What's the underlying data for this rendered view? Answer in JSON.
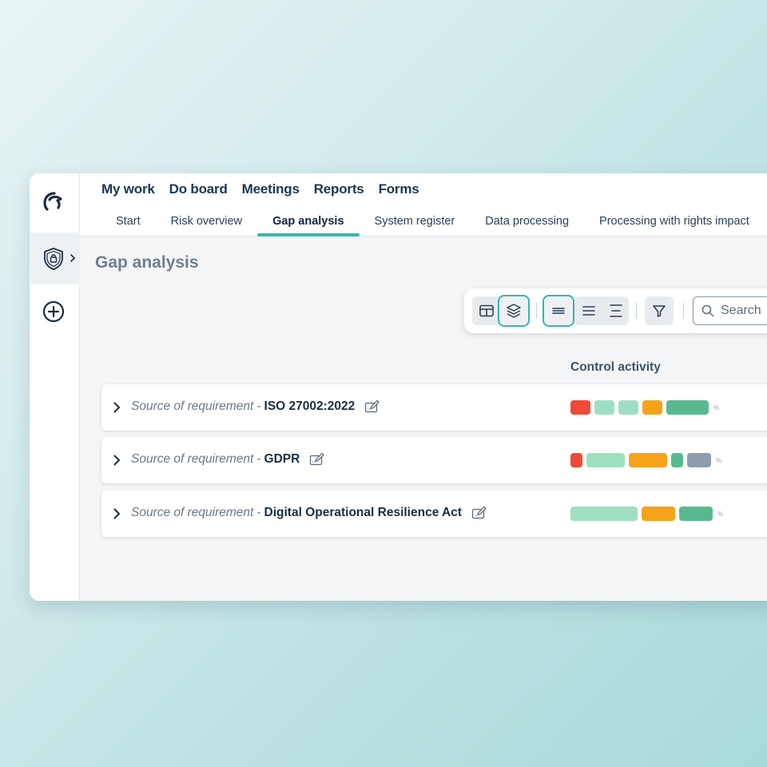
{
  "nav": {
    "items": [
      {
        "label": "My work"
      },
      {
        "label": "Do board"
      },
      {
        "label": "Meetings"
      },
      {
        "label": "Reports"
      },
      {
        "label": "Forms"
      }
    ]
  },
  "tabs": [
    {
      "label": "Start",
      "active": false
    },
    {
      "label": "Risk overview",
      "active": false
    },
    {
      "label": "Gap analysis",
      "active": true
    },
    {
      "label": "System register",
      "active": false
    },
    {
      "label": "Data processing",
      "active": false
    },
    {
      "label": "Processing with rights impact",
      "active": false
    }
  ],
  "page": {
    "title": "Gap analysis"
  },
  "toolbar": {
    "buttons": [
      {
        "icon": "table-view-icon",
        "selected": false
      },
      {
        "icon": "layers-icon",
        "selected": true
      },
      {
        "icon": "density-compact-icon",
        "selected": true
      },
      {
        "icon": "density-medium-icon",
        "selected": false
      },
      {
        "icon": "density-comfortable-icon",
        "selected": false
      },
      {
        "icon": "filter-icon",
        "selected": false
      }
    ],
    "search_placeholder": "Search"
  },
  "table": {
    "column_header": "Control activity",
    "rows": [
      {
        "prefix": "Source of requirement",
        "separator": "-",
        "name": "ISO 27002:2022",
        "status_bar": [
          {
            "status": "red",
            "color": "#f04a36",
            "share": 0.13
          },
          {
            "status": "light-green",
            "color": "#9de0c1",
            "share": 0.13
          },
          {
            "status": "light-green",
            "color": "#9de0c1",
            "share": 0.13
          },
          {
            "status": "orange",
            "color": "#f6a31b",
            "share": 0.13
          },
          {
            "status": "green",
            "color": "#58b98e",
            "share": 0.28
          }
        ],
        "pct_label": "%"
      },
      {
        "prefix": "Source of requirement",
        "separator": "-",
        "name": "GDPR",
        "status_bar": [
          {
            "status": "red",
            "color": "#f04a36",
            "share": 0.08
          },
          {
            "status": "light-green",
            "color": "#9de0c1",
            "share": 0.25
          },
          {
            "status": "orange",
            "color": "#f6a31b",
            "share": 0.25
          },
          {
            "status": "green",
            "color": "#58b98e",
            "share": 0.08
          },
          {
            "status": "gray",
            "color": "#8b9daf",
            "share": 0.16
          }
        ],
        "pct_label": "%"
      },
      {
        "prefix": "Source of requirement",
        "separator": "-",
        "name": "Digital Operational Resilience Act",
        "status_bar": [
          {
            "status": "light-green",
            "color": "#9de0c1",
            "share": 0.44
          },
          {
            "status": "orange",
            "color": "#f6a31b",
            "share": 0.22
          },
          {
            "status": "green",
            "color": "#58b98e",
            "share": 0.22
          }
        ],
        "pct_label": "%"
      }
    ]
  },
  "colors": {
    "accent": "#38b5b0",
    "nav_text": "#1d3550"
  }
}
